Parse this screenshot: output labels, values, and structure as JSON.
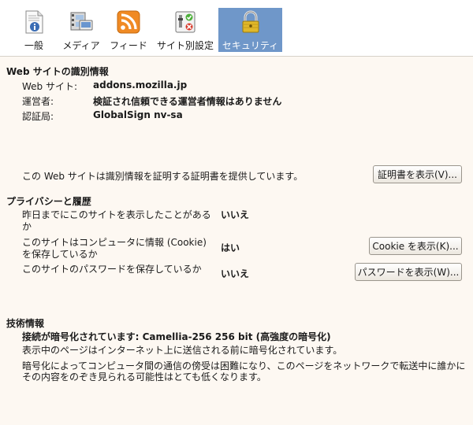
{
  "toolbar": {
    "items": [
      {
        "label": "一般",
        "icon": "info-document-icon"
      },
      {
        "label": "メディア",
        "icon": "media-film-icon"
      },
      {
        "label": "フィード",
        "icon": "rss-feed-icon"
      },
      {
        "label": "サイト別設定",
        "icon": "site-permissions-icon"
      },
      {
        "label": "セキュリティ",
        "icon": "padlock-icon",
        "selected": true
      }
    ]
  },
  "identity": {
    "title": "Web サイトの識別情報",
    "website_label": "Web サイト:",
    "website_value": "addons.mozilla.jp",
    "owner_label": "運営者:",
    "owner_value": "検証され信頼できる運営者情報はありません",
    "verifier_label": "認証局:",
    "verifier_value": "GlobalSign nv-sa",
    "cert_text": "この Web サイトは識別情報を証明する証明書を提供しています。",
    "cert_button": "証明書を表示(V)..."
  },
  "privacy": {
    "title": "プライバシーと履歴",
    "visited_q_line1": "昨日までにこのサイトを表示したことがある",
    "visited_q_line2": "か",
    "visited_a": "いいえ",
    "cookie_q_line1": "このサイトはコンピュータに情報 (Cookie)",
    "cookie_q_line2": "を保存しているか",
    "cookie_a": "はい",
    "cookie_button": "Cookie を表示(K)...",
    "password_q": "このサイトのパスワードを保存しているか",
    "password_a": "いいえ",
    "password_button": "パスワードを表示(W)..."
  },
  "technical": {
    "title": "技術情報",
    "encryption": "接続が暗号化されています: Camellia-256 256 bit (高強度の暗号化)",
    "line1": "表示中のページはインターネット上に送信される前に暗号化されています。",
    "line2": "暗号化によってコンピュータ間の通信の傍受は困難になり、このページをネットワークで転送中に誰かに",
    "line3": "その内容をのぞき見られる可能性はとても低くなります。"
  },
  "colors": {
    "selected_tab": "#6f97c9",
    "background": "#fdf8f2",
    "rss_orange": "#f08a24"
  }
}
